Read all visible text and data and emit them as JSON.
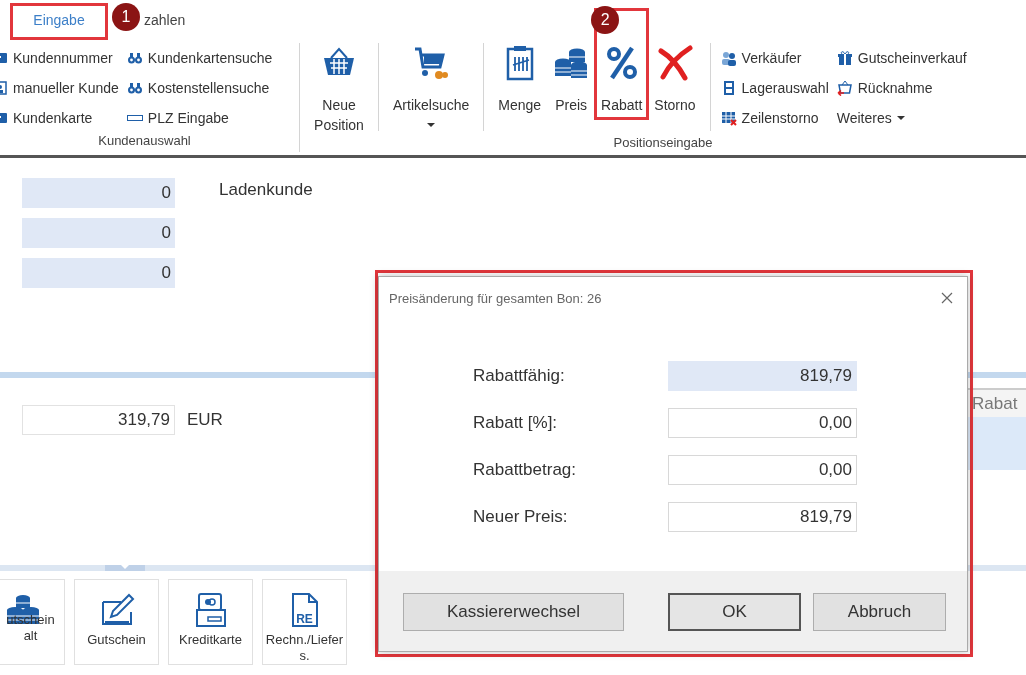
{
  "tabs": [
    {
      "label": "Eingabe",
      "selected": true,
      "marker": "1"
    },
    {
      "label": "zahlen",
      "selected": false
    }
  ],
  "ribbon": {
    "groups": [
      {
        "label": "Kundenauswahl",
        "sections": [
          {
            "kind": "small",
            "items": [
              {
                "label": "Kundennummer",
                "kind": "card"
              },
              {
                "label": "manueller Kunde",
                "kind": "person"
              },
              {
                "label": "Kundenkarte",
                "kind": "card"
              },
              {
                "label": "Kundenkartensuche",
                "kind": "binoculars"
              },
              {
                "label": "Kostenstellensuche",
                "kind": "binoculars"
              },
              {
                "label": "PLZ Eingabe",
                "kind": "textbox"
              }
            ]
          }
        ]
      },
      {
        "label": "Positionseingabe",
        "sections": [
          {
            "kind": "large",
            "items": [
              {
                "label": "Neue Position",
                "kind": "basket"
              }
            ]
          },
          {
            "kind": "large",
            "items": [
              {
                "label": "Artikelsuche",
                "kind": "cart",
                "dropdown": true
              }
            ]
          },
          {
            "kind": "large",
            "items": [
              {
                "label": "Menge",
                "kind": "clipboard"
              },
              {
                "label": "Preis",
                "kind": "coins"
              },
              {
                "label": "Rabatt",
                "kind": "percent",
                "marker": "2"
              },
              {
                "label": "Storno",
                "kind": "cross"
              }
            ]
          },
          {
            "kind": "small",
            "items": [
              {
                "label": "Verkäufer",
                "kind": "people"
              },
              {
                "label": "Lagerauswahl",
                "kind": "shelf"
              },
              {
                "label": "Zeilenstorno",
                "kind": "tablex"
              },
              {
                "label": "Gutscheinverkauf",
                "kind": "gift"
              },
              {
                "label": "Rücknahme",
                "kind": "return"
              },
              {
                "label": "Weiteres",
                "kind": "menu",
                "dropdown": true
              }
            ]
          }
        ]
      }
    ]
  },
  "customer": {
    "fields": [
      "0",
      "0",
      "0"
    ],
    "name": "Ladenkunde"
  },
  "total": {
    "value": "319,79",
    "currency": "EUR"
  },
  "side_panel": {
    "header": "Rabat"
  },
  "tiles": [
    {
      "label": "utschein alt",
      "kind": "coins"
    },
    {
      "label": "Gutschein",
      "kind": "pen"
    },
    {
      "label": "Kreditkarte",
      "kind": "cardreader"
    },
    {
      "label": "Rechn./Liefers.",
      "kind": "document",
      "icon_text": "RE"
    }
  ],
  "dialog": {
    "title": "Preisänderung für gesamten Bon: 26",
    "highlighted": true,
    "rows": [
      {
        "label": "Rabattfähig:",
        "value": "819,79",
        "readonly": true
      },
      {
        "label": "Rabatt [%]:",
        "value": "0,00",
        "readonly": false
      },
      {
        "label": "Rabattbetrag:",
        "value": "0,00",
        "readonly": false
      },
      {
        "label": "Neuer Preis:",
        "value": "819,79",
        "readonly": false
      }
    ],
    "buttons": [
      {
        "label": "Kassiererwechsel",
        "default": false
      },
      {
        "label": "OK",
        "default": true
      },
      {
        "label": "Abbruch",
        "default": false
      }
    ]
  }
}
